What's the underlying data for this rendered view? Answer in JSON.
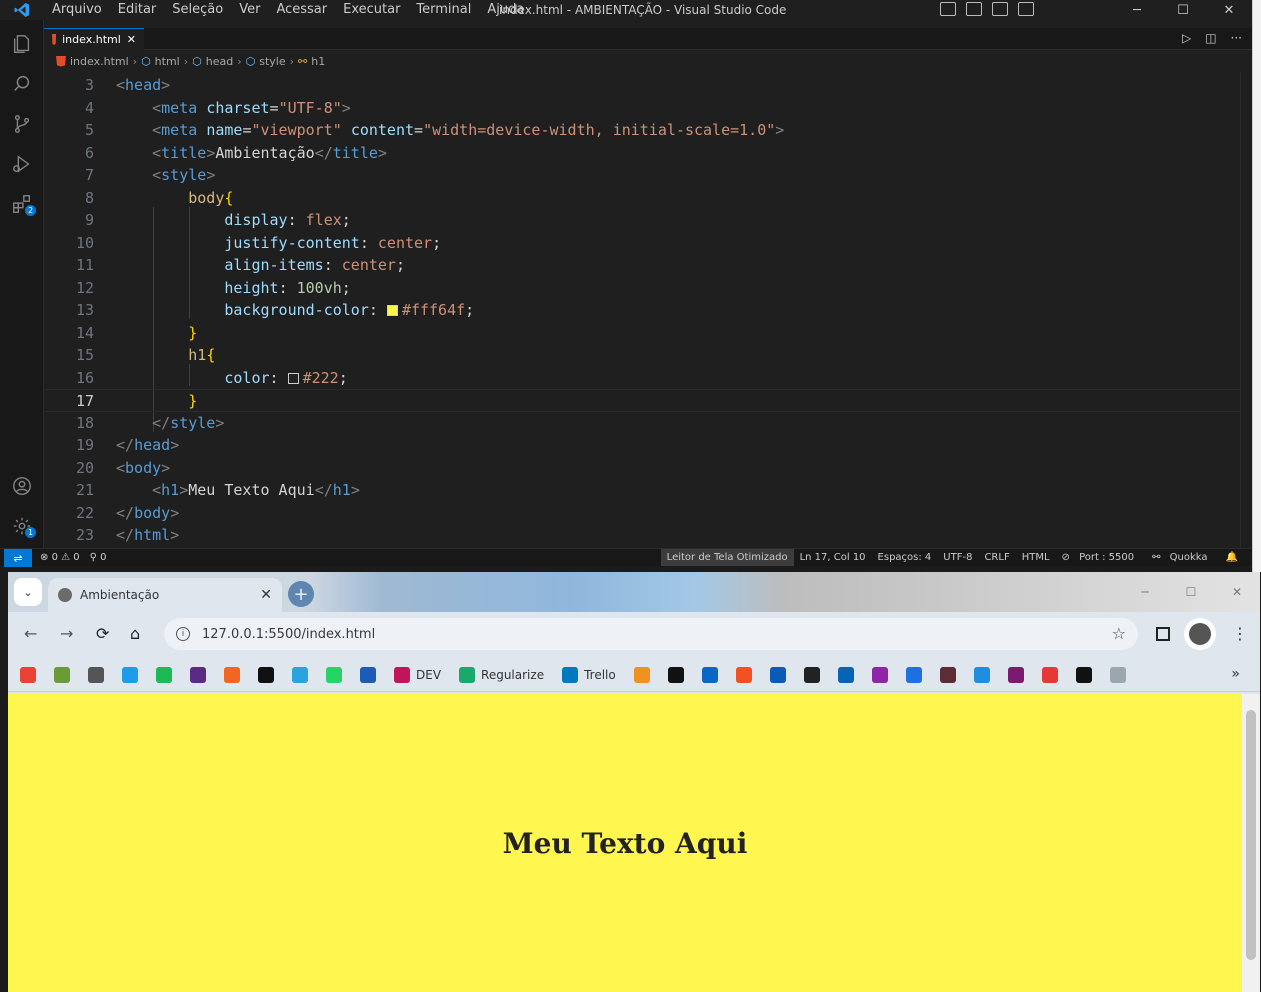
{
  "vscode": {
    "menu": [
      "Arquivo",
      "Editar",
      "Seleção",
      "Ver",
      "Acessar",
      "Executar",
      "Terminal",
      "Ajuda"
    ],
    "window_title": "index.html - AMBIENTAÇÃO - Visual Studio Code",
    "tab_label": "index.html",
    "tab_close": "✕",
    "breadcrumb": [
      "index.html",
      "html",
      "head",
      "style",
      "h1"
    ],
    "extensions_badge": "2",
    "settings_badge": "1",
    "current_line": 17,
    "lines": [
      {
        "n": "3",
        "html": "<span class='tb'>&lt;</span><span class='t'>head</span><span class='tb'>&gt;</span>"
      },
      {
        "n": "4",
        "html": "    <span class='tb'>&lt;</span><span class='t'>meta</span> <span class='a'>charset</span><span class='w'>=</span><span class='s'>\"UTF-8\"</span><span class='tb'>&gt;</span>"
      },
      {
        "n": "5",
        "html": "    <span class='tb'>&lt;</span><span class='t'>meta</span> <span class='a'>name</span><span class='w'>=</span><span class='s'>\"viewport\"</span> <span class='a'>content</span><span class='w'>=</span><span class='s'>\"width=device-width, initial-scale=1.0\"</span><span class='tb'>&gt;</span>"
      },
      {
        "n": "6",
        "html": "    <span class='tb'>&lt;</span><span class='t'>title</span><span class='tb'>&gt;</span><span class='w'>Ambientação</span><span class='tb'>&lt;/</span><span class='t'>title</span><span class='tb'>&gt;</span>"
      },
      {
        "n": "7",
        "html": "    <span class='tb'>&lt;</span><span class='t'>style</span><span class='tb'>&gt;</span>"
      },
      {
        "n": "8",
        "html": "        <span class='sel'>body</span><span class='br'>{</span>"
      },
      {
        "n": "9",
        "html": "            <span class='p'>display</span><span class='w'>: </span><span class='v'>flex</span><span class='w'>;</span>"
      },
      {
        "n": "10",
        "html": "            <span class='p'>justify-content</span><span class='w'>: </span><span class='v'>center</span><span class='w'>;</span>"
      },
      {
        "n": "11",
        "html": "            <span class='p'>align-items</span><span class='w'>: </span><span class='v'>center</span><span class='w'>;</span>"
      },
      {
        "n": "12",
        "html": "            <span class='p'>height</span><span class='w'>: </span><span class='n'>100vh</span><span class='w'>;</span>"
      },
      {
        "n": "13",
        "html": "            <span class='p'>background-color</span><span class='w'>: </span><span class='sw' style='background:#fff64f'></span><span class='v'>#fff64f</span><span class='w'>;</span>"
      },
      {
        "n": "14",
        "html": "        <span class='br'>}</span>"
      },
      {
        "n": "15",
        "html": "        <span class='sel'>h1</span><span class='br'>{</span>"
      },
      {
        "n": "16",
        "html": "            <span class='p'>color</span><span class='w'>: </span><span class='sw' style='background:#222'></span><span class='v'>#222</span><span class='w'>;</span>"
      },
      {
        "n": "17",
        "html": "        <span class='br'>}</span>"
      },
      {
        "n": "18",
        "html": "    <span class='tb'>&lt;/</span><span class='t'>style</span><span class='tb'>&gt;</span>"
      },
      {
        "n": "19",
        "html": "<span class='tb'>&lt;/</span><span class='t'>head</span><span class='tb'>&gt;</span>"
      },
      {
        "n": "20",
        "html": "<span class='tb'>&lt;</span><span class='t'>body</span><span class='tb'>&gt;</span>"
      },
      {
        "n": "21",
        "html": "    <span class='tb'>&lt;</span><span class='t'>h1</span><span class='tb'>&gt;</span><span class='w'>Meu Texto Aqui</span><span class='tb'>&lt;/</span><span class='t'>h1</span><span class='tb'>&gt;</span>"
      },
      {
        "n": "22",
        "html": "<span class='tb'>&lt;/</span><span class='t'>body</span><span class='tb'>&gt;</span>"
      },
      {
        "n": "23",
        "html": "<span class='tb'>&lt;/</span><span class='t'>html</span><span class='tb'>&gt;</span>"
      }
    ],
    "status": {
      "errors": "0",
      "warnings": "0",
      "ports": "0",
      "screen_reader": "Leitor de Tela Otimizado",
      "position": "Ln 17, Col 10",
      "spaces": "Espaços: 4",
      "encoding": "UTF-8",
      "eol": "CRLF",
      "language": "HTML",
      "port": "Port : 5500",
      "quokka": "Quokka"
    }
  },
  "chrome": {
    "tab_title": "Ambientação",
    "url": "127.0.0.1:5500/index.html",
    "bookmarks": [
      {
        "label": "",
        "color": "#e94235"
      },
      {
        "label": "",
        "color": "#6b9b37"
      },
      {
        "label": "",
        "color": "#555555"
      },
      {
        "label": "",
        "color": "#1e9be9"
      },
      {
        "label": "",
        "color": "#1db954"
      },
      {
        "label": "",
        "color": "#5b2a86"
      },
      {
        "label": "",
        "color": "#f26522"
      },
      {
        "label": "",
        "color": "#111111"
      },
      {
        "label": "",
        "color": "#2aa3df"
      },
      {
        "label": "",
        "color": "#25d366"
      },
      {
        "label": "",
        "color": "#1a5cb8"
      },
      {
        "label": "DEV",
        "color": "#c0145c"
      },
      {
        "label": "Regularize",
        "color": "#1aa86b"
      },
      {
        "label": "Trello",
        "color": "#0079bf"
      },
      {
        "label": "",
        "color": "#f09220"
      },
      {
        "label": "",
        "color": "#111111"
      },
      {
        "label": "",
        "color": "#0a66c2"
      },
      {
        "label": "",
        "color": "#f25022"
      },
      {
        "label": "",
        "color": "#0b5ab8"
      },
      {
        "label": "",
        "color": "#222222"
      },
      {
        "label": "",
        "color": "#0364b8"
      },
      {
        "label": "",
        "color": "#8e24aa"
      },
      {
        "label": "",
        "color": "#1e6fe0"
      },
      {
        "label": "",
        "color": "#5c2d36"
      },
      {
        "label": "",
        "color": "#1f8de0"
      },
      {
        "label": "",
        "color": "#7a1b6f"
      },
      {
        "label": "",
        "color": "#e53935"
      },
      {
        "label": "",
        "color": "#111111"
      },
      {
        "label": "",
        "color": "#9aa6b0"
      }
    ],
    "page_heading": "Meu Texto Aqui",
    "page_bg": "#fff64f",
    "page_text_color": "#222"
  }
}
